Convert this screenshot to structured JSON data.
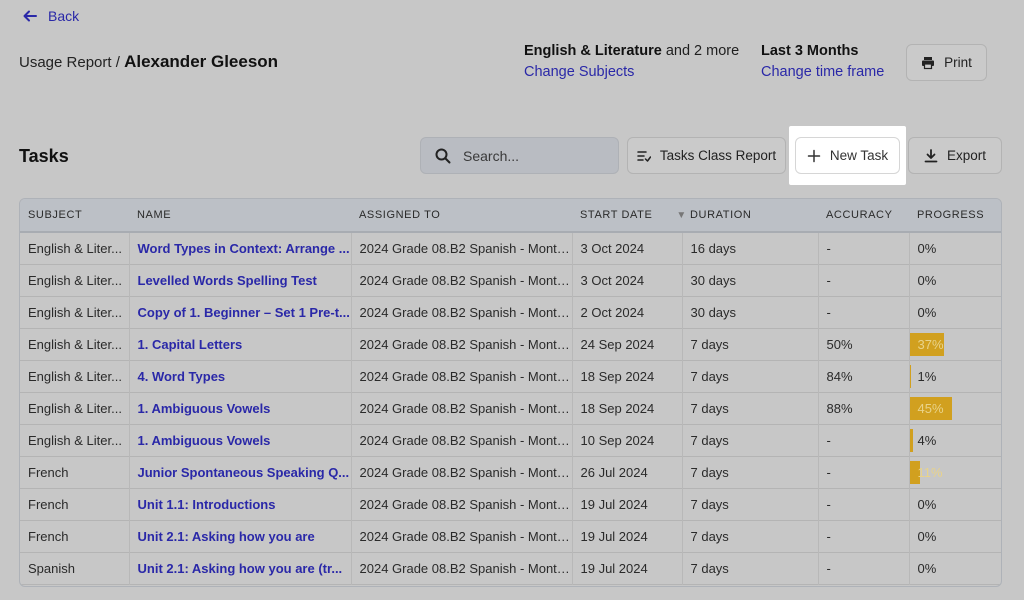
{
  "back_label": "Back",
  "breadcrumb": {
    "prefix": "Usage Report /",
    "student": "Alexander Gleeson"
  },
  "subjects": {
    "main": "English & Literature",
    "suffix": "and 2 more",
    "link": "Change Subjects"
  },
  "timeframe": {
    "value": "Last 3 Months",
    "link": "Change time frame"
  },
  "print_label": "Print",
  "tasks_heading": "Tasks",
  "search": {
    "placeholder": "Search..."
  },
  "class_report_label": "Tasks Class Report",
  "new_task_label": "New Task",
  "export_label": "Export",
  "columns": [
    "SUBJECT",
    "NAME",
    "ASSIGNED TO",
    "START DATE",
    "DURATION",
    "ACCURACY",
    "PROGRESS"
  ],
  "rows": [
    {
      "subject": "English & Liter...",
      "name": "Word Types in Context: Arrange ...",
      "assigned": "2024 Grade 08.B2 Spanish - Monta...",
      "start": "3 Oct 2024",
      "duration": "16 days",
      "accuracy": "-",
      "progress": "0%"
    },
    {
      "subject": "English & Liter...",
      "name": "Levelled Words Spelling Test",
      "assigned": "2024 Grade 08.B2 Spanish - Monta...",
      "start": "3 Oct 2024",
      "duration": "30 days",
      "accuracy": "-",
      "progress": "0%"
    },
    {
      "subject": "English & Liter...",
      "name": "Copy of 1. Beginner – Set 1 Pre-t...",
      "assigned": "2024 Grade 08.B2 Spanish - Monta...",
      "start": "2 Oct 2024",
      "duration": "30 days",
      "accuracy": "-",
      "progress": "0%"
    },
    {
      "subject": "English & Liter...",
      "name": "1. Capital Letters",
      "assigned": "2024 Grade 08.B2 Spanish - Monta...",
      "start": "24 Sep 2024",
      "duration": "7 days",
      "accuracy": "50%",
      "progress": "37%"
    },
    {
      "subject": "English & Liter...",
      "name": "4. Word Types",
      "assigned": "2024 Grade 08.B2 Spanish - Monta...",
      "start": "18 Sep 2024",
      "duration": "7 days",
      "accuracy": "84%",
      "progress": "1%"
    },
    {
      "subject": "English & Liter...",
      "name": "1. Ambiguous Vowels",
      "assigned": "2024 Grade 08.B2 Spanish - Monta...",
      "start": "18 Sep 2024",
      "duration": "7 days",
      "accuracy": "88%",
      "progress": "45%"
    },
    {
      "subject": "English & Liter...",
      "name": "1. Ambiguous Vowels",
      "assigned": "2024 Grade 08.B2 Spanish - Monta...",
      "start": "10 Sep 2024",
      "duration": "7 days",
      "accuracy": "-",
      "progress": "4%"
    },
    {
      "subject": "French",
      "name": "Junior Spontaneous Speaking Q...",
      "assigned": "2024 Grade 08.B2 Spanish - Monta...",
      "start": "26 Jul 2024",
      "duration": "7 days",
      "accuracy": "-",
      "progress": "11%"
    },
    {
      "subject": "French",
      "name": "Unit 1.1: Introductions",
      "assigned": "2024 Grade 08.B2 Spanish - Monta...",
      "start": "19 Jul 2024",
      "duration": "7 days",
      "accuracy": "-",
      "progress": "0%"
    },
    {
      "subject": "French",
      "name": "Unit 2.1: Asking how you are",
      "assigned": "2024 Grade 08.B2 Spanish - Monta...",
      "start": "19 Jul 2024",
      "duration": "7 days",
      "accuracy": "-",
      "progress": "0%"
    },
    {
      "subject": "Spanish",
      "name": "Unit 2.1: Asking how you are (tr...",
      "assigned": "2024 Grade 08.B2 Spanish - Monta...",
      "start": "19 Jul 2024",
      "duration": "7 days",
      "accuracy": "-",
      "progress": "0%"
    }
  ],
  "colors": {
    "link": "#2a28a8",
    "progress_bar": "#d1a01f",
    "overlay_bg": "#c7c7c7",
    "highlight": "#ffffff"
  }
}
